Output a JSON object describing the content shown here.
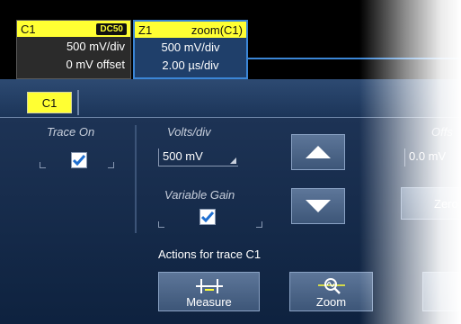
{
  "descriptors": {
    "c1": {
      "name": "C1",
      "coupling": "DC50",
      "vdiv": "500 mV/div",
      "offset": "0 mV offset"
    },
    "z1": {
      "name": "Z1",
      "source": "zoom(C1)",
      "vdiv": "500 mV/div",
      "tdiv": "2.00 µs/div"
    }
  },
  "tab": {
    "label": "C1"
  },
  "trace_on": {
    "label": "Trace On",
    "checked": true
  },
  "volts_div": {
    "label": "Volts/div",
    "value": "500 mV"
  },
  "variable_gain": {
    "label": "Variable Gain",
    "checked": true
  },
  "offset": {
    "label": "Offs",
    "value": "0.0 mV"
  },
  "zero_button": {
    "label": "Zero"
  },
  "actions": {
    "title": "Actions for trace C1",
    "measure": "Measure",
    "zoom": "Zoom"
  },
  "colors": {
    "trace_c1": "#ffff33",
    "zoom_accent": "#3b86d6",
    "panel": "#1d3355"
  }
}
